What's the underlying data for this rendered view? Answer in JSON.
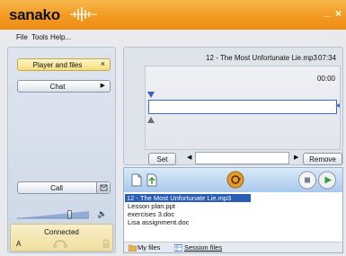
{
  "app": {
    "logo_text": "sanako",
    "minimize_glyph": "_",
    "close_glyph": "×"
  },
  "menu": [
    "File",
    "Tools",
    "Help..."
  ],
  "left_panel": {
    "player_files_label": "Player and files",
    "player_files_close": "×",
    "chat_label": "Chat",
    "call_label": "Call",
    "volume_level": 0.7,
    "connected_label": "Connected",
    "seat_letter": "A"
  },
  "track_panel": {
    "track_title": "12 - The Most Unfortunate Lie.mp3",
    "duration": "07:34",
    "position_time": "00:00",
    "set_label": "Set",
    "remove_label": "Remove"
  },
  "player": {
    "files": [
      "12 - The Most Unfortunate Lie.mp3",
      "Lesson plan.ppt",
      "exercises 3.doc",
      "Lisa assignment.doc"
    ],
    "selected_index": 0,
    "tabs": [
      "My files",
      "Session files"
    ]
  },
  "colors": {
    "title_orange": "#f29a22",
    "selection_blue": "#2a5db5",
    "play_green": "#3a9a3a"
  }
}
